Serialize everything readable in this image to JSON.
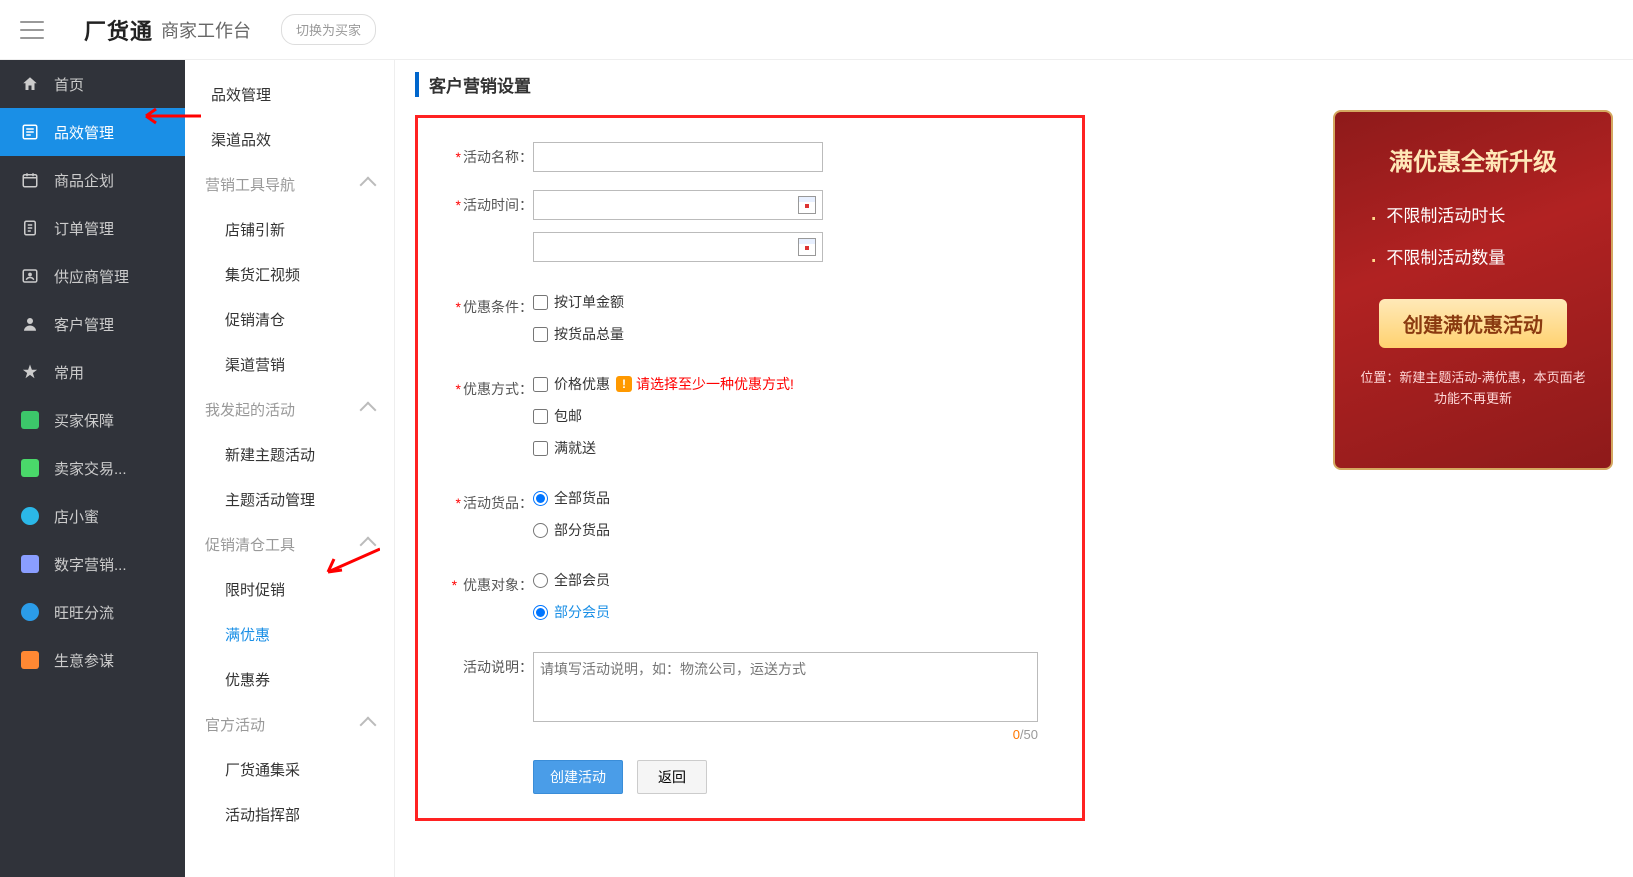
{
  "header": {
    "logo": "厂货通",
    "logo_sub": "商家工作台",
    "switch_buyer": "切换为买家"
  },
  "primary_nav": [
    {
      "id": "home",
      "label": "首页"
    },
    {
      "id": "product-effect",
      "label": "品效管理",
      "active": true
    },
    {
      "id": "product-plan",
      "label": "商品企划"
    },
    {
      "id": "order",
      "label": "订单管理"
    },
    {
      "id": "supplier",
      "label": "供应商管理"
    },
    {
      "id": "customer",
      "label": "客户管理"
    },
    {
      "id": "favorite",
      "label": "常用"
    },
    {
      "id": "buyer-guarantee",
      "label": "买家保障"
    },
    {
      "id": "seller-trade",
      "label": "卖家交易..."
    },
    {
      "id": "shop-assist",
      "label": "店小蜜"
    },
    {
      "id": "digital-marketing",
      "label": "数字营销..."
    },
    {
      "id": "wangwang",
      "label": "旺旺分流"
    },
    {
      "id": "business-ref",
      "label": "生意参谋"
    }
  ],
  "secondary_nav": {
    "top": [
      "品效管理",
      "渠道品效"
    ],
    "groups": [
      {
        "header": "营销工具导航",
        "items": [
          "店铺引新",
          "集货汇视频",
          "促销清仓",
          "渠道营销"
        ]
      },
      {
        "header": "我发起的活动",
        "items": [
          "新建主题活动",
          "主题活动管理"
        ]
      },
      {
        "header": "促销清仓工具",
        "items": [
          "限时促销",
          {
            "label": "满优惠",
            "active": true
          },
          "优惠券"
        ]
      },
      {
        "header": "官方活动",
        "items": [
          "厂货通集采",
          "活动指挥部"
        ]
      }
    ]
  },
  "content": {
    "section_title": "客户营销设置",
    "fields": {
      "name_label": "活动名称：",
      "time_label": "活动时间：",
      "cond_label": "优惠条件：",
      "cond_opt1": "按订单金额",
      "cond_opt2": "按货品总量",
      "method_label": "优惠方式：",
      "method_opt1": "价格优惠",
      "method_err": "请选择至少一种优惠方式!",
      "method_opt2": "包邮",
      "method_opt3": "满就送",
      "goods_label": "活动货品：",
      "goods_opt1": "全部货品",
      "goods_opt2": "部分货品",
      "target_label": "优惠对象：",
      "target_opt1": "全部会员",
      "target_opt2": "部分会员",
      "desc_label": "活动说明：",
      "desc_placeholder": "请填写活动说明，如：物流公司，运送方式",
      "char_count_current": "0",
      "char_count_sep": "/50",
      "btn_create": "创建活动",
      "btn_back": "返回"
    }
  },
  "promo": {
    "title": "满优惠全新升级",
    "bullets": [
      "不限制活动时长",
      "不限制活动数量"
    ],
    "button": "创建满优惠活动",
    "note": "位置：新建主题活动-满优惠，本页面老功能不再更新"
  }
}
